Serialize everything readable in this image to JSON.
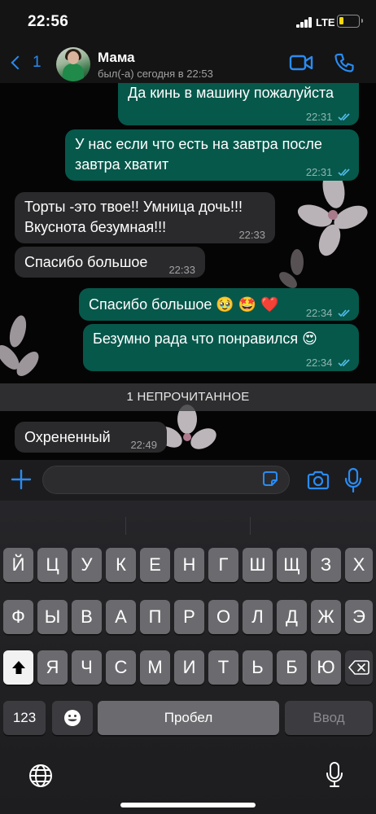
{
  "status_bar": {
    "time": "22:56",
    "network": "LTE",
    "battery_color": "#f5d90a"
  },
  "header": {
    "back_count": "1",
    "contact_name": "Мама",
    "contact_status": "был(-а) сегодня в 22:53",
    "accent_color": "#2a8bf2",
    "icons": [
      "chevron-left-icon",
      "video-call-icon",
      "phone-call-icon"
    ]
  },
  "messages": [
    {
      "direction": "outgoing",
      "text": "Да кинь в машину пожалуйста",
      "time": "22:31",
      "status": "read"
    },
    {
      "direction": "outgoing",
      "text_line1": "У нас если что есть на завтра после",
      "text_line2": "завтра хватит",
      "time": "22:31",
      "status": "read"
    },
    {
      "direction": "incoming",
      "text_line1": "Торты -это твое!! Умница дочь!!!",
      "text_line2": "Вкуснота безумная!!!",
      "time": "22:33"
    },
    {
      "direction": "incoming",
      "text": "Спасибо большое",
      "time": "22:33"
    },
    {
      "direction": "outgoing",
      "text": "Спасибо большое 🥹 🤩 ❤️",
      "time": "22:34",
      "status": "read"
    },
    {
      "direction": "outgoing",
      "text": "Безумно рада что понравился 😍",
      "time": "22:34",
      "status": "read"
    },
    {
      "direction": "incoming",
      "text": "Охрененный",
      "time": "22:49"
    }
  ],
  "unread_divider": "1 НЕПРОЧИТАННОЕ",
  "composer": {
    "input_value": "",
    "icons": [
      "plus-icon",
      "sticker-icon",
      "camera-icon",
      "microphone-icon"
    ]
  },
  "keyboard": {
    "row1": [
      "Й",
      "Ц",
      "У",
      "К",
      "Е",
      "Н",
      "Г",
      "Ш",
      "Щ",
      "З",
      "Х"
    ],
    "row2": [
      "Ф",
      "Ы",
      "В",
      "А",
      "П",
      "Р",
      "О",
      "Л",
      "Д",
      "Ж",
      "Э"
    ],
    "row3": [
      "Я",
      "Ч",
      "С",
      "М",
      "И",
      "Т",
      "Ь",
      "Б",
      "Ю"
    ],
    "numbers_key": "123",
    "space_key": "Пробел",
    "return_key": "Ввод",
    "icons": [
      "shift-icon",
      "backspace-icon",
      "emoji-icon",
      "globe-icon",
      "dictation-mic-icon"
    ]
  },
  "colors": {
    "outgoing_bubble": "#06584b",
    "incoming_bubble": "#2a2a2c",
    "read_ticks": "#53bdeb"
  }
}
